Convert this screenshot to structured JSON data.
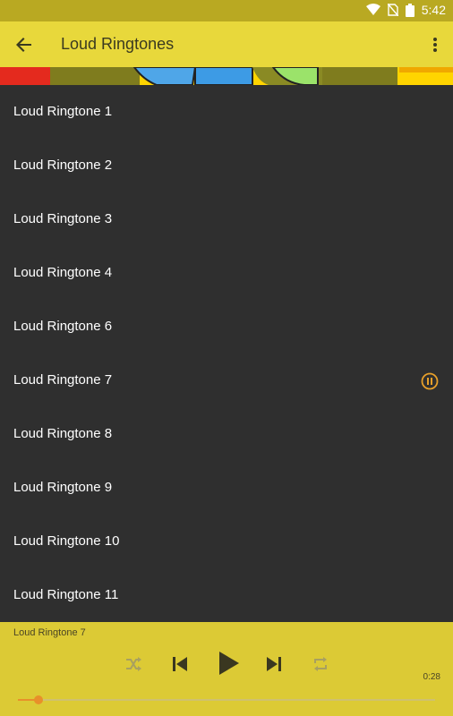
{
  "status": {
    "time": "5:42"
  },
  "appbar": {
    "title": "Loud Ringtones"
  },
  "list": {
    "items": [
      {
        "label": "Loud Ringtone 1",
        "playing": false
      },
      {
        "label": "Loud Ringtone 2",
        "playing": false
      },
      {
        "label": "Loud Ringtone 3",
        "playing": false
      },
      {
        "label": "Loud Ringtone 4",
        "playing": false
      },
      {
        "label": "Loud Ringtone 6",
        "playing": false
      },
      {
        "label": "Loud Ringtone 7",
        "playing": true
      },
      {
        "label": "Loud Ringtone 8",
        "playing": false
      },
      {
        "label": "Loud Ringtone 9",
        "playing": false
      },
      {
        "label": "Loud Ringtone 10",
        "playing": false
      },
      {
        "label": "Loud Ringtone 11",
        "playing": false
      }
    ]
  },
  "player": {
    "now_playing": "Loud Ringtone 7",
    "elapsed": "0:28",
    "progress": 0.05
  },
  "colors": {
    "statusbar": "#b9a922",
    "appbar": "#e8d83b",
    "list_bg": "#2f2f2f",
    "player_bg": "#dcca35",
    "accent": "#e8902a"
  }
}
